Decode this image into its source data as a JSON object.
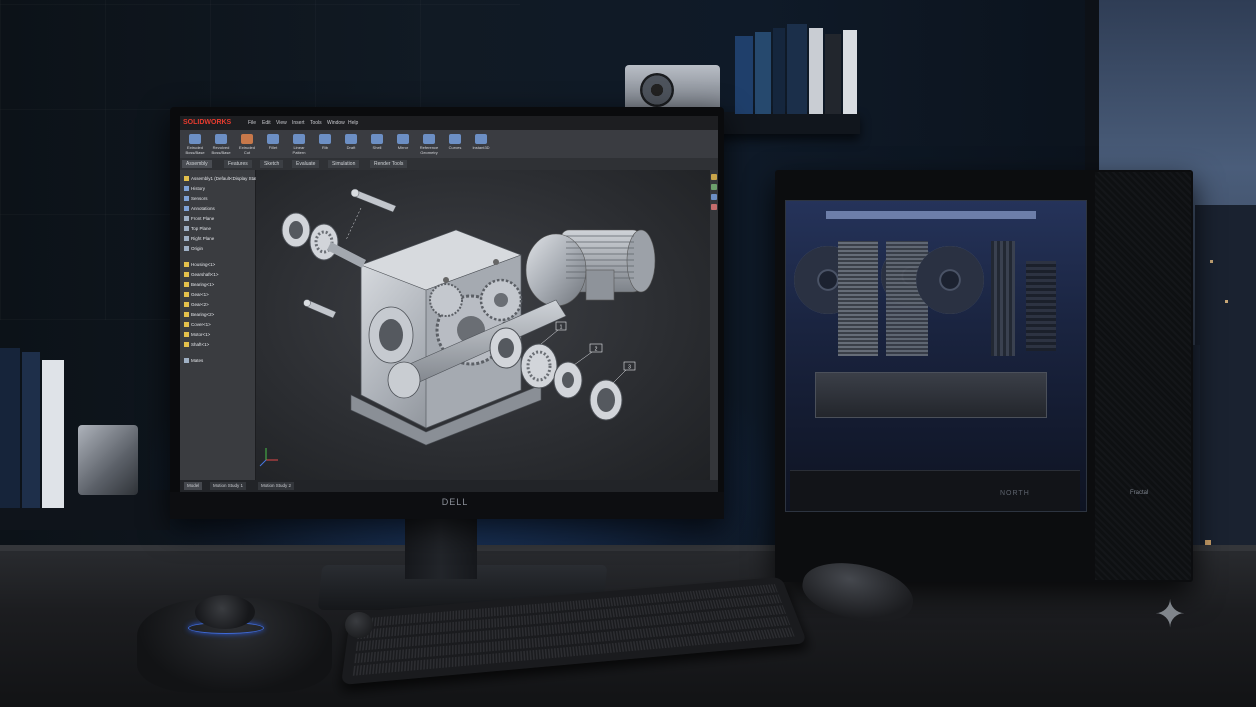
{
  "scene": {
    "description_tags": [
      "desk",
      "monitor",
      "desktop-pc",
      "keyboard",
      "mouse",
      "3d-mouse"
    ],
    "accent_colors": {
      "ambient_blue": "#2c58d0",
      "cad_logo_red": "#e63b2e",
      "cad_part_gray": "#b8bcc3"
    }
  },
  "monitor": {
    "brand": "DELL"
  },
  "cad_app": {
    "logo": "SOLIDWORKS",
    "menus": [
      "File",
      "Edit",
      "View",
      "Insert",
      "Tools",
      "Window",
      "Help"
    ],
    "ribbon_buttons": [
      "Extruded Boss/Base",
      "Revolved Boss/Base",
      "Extruded Cut",
      "Fillet",
      "Linear Pattern",
      "Rib",
      "Draft",
      "Shell",
      "Mirror",
      "Reference Geometry",
      "Curves",
      "Instant3D"
    ],
    "command_tabs": [
      "Assembly",
      "Features",
      "Sketch",
      "Evaluate",
      "Simulation",
      "Render Tools"
    ],
    "tree_items": [
      "Assembly1 (Default<Display State-1>)",
      "History",
      "Sensors",
      "Annotations",
      "Front Plane",
      "Top Plane",
      "Right Plane",
      "Origin",
      "Housing<1>",
      "Gearshaft<1>",
      "Bearing<1>",
      "Gear<1>",
      "Gear<2>",
      "Bearing<2>",
      "Cover<1>",
      "Motor<1>",
      "Shaft<1>",
      "Mates"
    ],
    "status_tabs": [
      "Model",
      "Motion Study 1",
      "Motion Study 2"
    ],
    "balloons": [
      "1",
      "2",
      "3"
    ]
  },
  "pc_case": {
    "badge": "Fractal",
    "shroud_label": "NORTH"
  }
}
